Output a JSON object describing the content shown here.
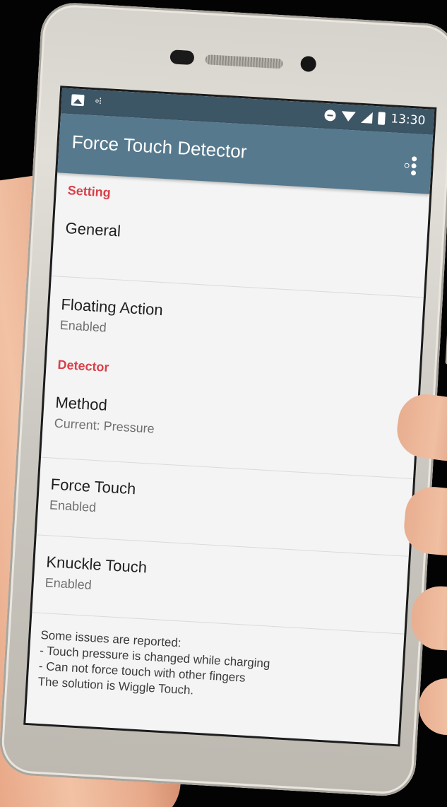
{
  "status_bar": {
    "time": "13:30"
  },
  "app_bar": {
    "title": "Force Touch Detector",
    "overflow_icon": "overflow-menu-icon"
  },
  "sections": {
    "setting": {
      "header": "Setting",
      "general": {
        "title": "General"
      },
      "floating_action": {
        "title": "Floating Action",
        "summary": "Enabled"
      }
    },
    "detector": {
      "header": "Detector",
      "method": {
        "title": "Method",
        "summary": "Current: Pressure"
      },
      "force_touch": {
        "title": "Force Touch",
        "summary": "Enabled"
      },
      "knuckle_touch": {
        "title": "Knuckle Touch",
        "summary": "Enabled"
      }
    }
  },
  "note": "Some issues are reported:\n- Touch pressure is changed while charging\n- Can not force touch with other fingers\nThe solution is Wiggle Touch.",
  "colors": {
    "app_bar": "#56798d",
    "status_bar": "#3c5666",
    "accent": "#d8404a",
    "background": "#f4f4f4"
  }
}
